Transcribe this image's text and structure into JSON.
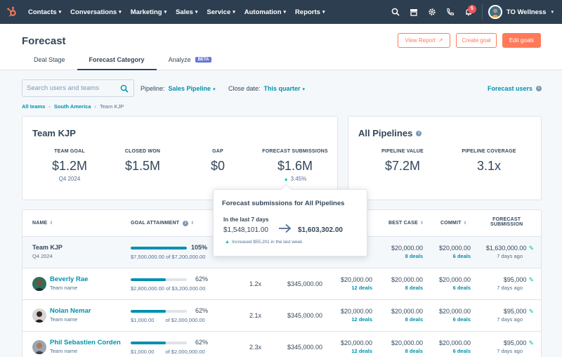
{
  "nav": {
    "items": [
      "Contacts",
      "Conversations",
      "Marketing",
      "Sales",
      "Service",
      "Automation",
      "Reports"
    ],
    "notification_count": "5",
    "account_name": "TO Wellness"
  },
  "header": {
    "title": "Forecast",
    "buttons": {
      "view_report": "View Report",
      "create_goal": "Create goal",
      "edit_goals": "Edit goals"
    },
    "tabs": [
      "Deal Stage",
      "Forecast Category",
      "Analyze"
    ],
    "beta_label": "BETA"
  },
  "filters": {
    "search_placeholder": "Search users and teams",
    "pipeline_label": "Pipeline:",
    "pipeline_value": "Sales Pipeline",
    "close_date_label": "Close date:",
    "close_date_value": "This quarter",
    "forecast_users": "Forecast users"
  },
  "breadcrumb": {
    "all_teams": "All teams",
    "region": "South America",
    "current": "Team KJP"
  },
  "team_card": {
    "title": "Team KJP",
    "metrics": [
      {
        "label": "TEAM GOAL",
        "value": "$1.2M",
        "sub": "Q4 2024"
      },
      {
        "label": "CLOSED WON",
        "value": "$1.5M",
        "sub": ""
      },
      {
        "label": "GAP",
        "value": "$0",
        "sub": ""
      },
      {
        "label": "FORECAST SUBMISSIONS",
        "value": "$1.6M",
        "sub": "3.45%"
      }
    ]
  },
  "pipelines_card": {
    "title": "All Pipelines",
    "metrics": [
      {
        "label": "PIPELINE VALUE",
        "value": "$7.2M"
      },
      {
        "label": "PIPELINE COVERAGE",
        "value": "3.1x"
      }
    ]
  },
  "popover": {
    "title": "Forecast submissions for All Pipelines",
    "period": "In the last 7 days",
    "from": "$1,548,101.00",
    "to": "$1,603,302.00",
    "increase": "Increased $55,201 in the last week"
  },
  "table": {
    "headers": {
      "name": "NAME",
      "goal": "GOAL ATTAINMENT",
      "best_case": "BEST CASE",
      "commit": "COMMIT",
      "forecast_1": "FORECAST",
      "forecast_2": "SUBMISSION"
    },
    "rows": [
      {
        "name": "Team KJP",
        "sub": "Q4 2024",
        "pct": "105%",
        "progress": 1.0,
        "attained": "$7,500,000.00",
        "goal": "of $7,200,000.00",
        "coverage": "",
        "pipeline": "",
        "col5": "",
        "col5_deals": "",
        "best": "$20,000.00",
        "best_deals": "8 deals",
        "commit": "$20,000.00",
        "commit_deals": "6 deals",
        "forecast": "$1,630,000.00",
        "forecast_ago": "7 days ago"
      },
      {
        "name": "Beverly Rae",
        "sub": "Team name",
        "pct": "62%",
        "progress": 0.62,
        "attained": "$2,800,000.00",
        "goal": "of $3,200,000.00",
        "coverage": "1.2x",
        "pipeline": "$345,000.00",
        "col5": "$20,000.00",
        "col5_deals": "12 deals",
        "best": "$20,000.00",
        "best_deals": "8 deals",
        "commit": "$20,000.00",
        "commit_deals": "6 deals",
        "forecast": "$95,000",
        "forecast_ago": "7 days ago"
      },
      {
        "name": "Nolan Nemar",
        "sub": "Team name",
        "pct": "62%",
        "progress": 0.62,
        "attained": "$1,000.00",
        "goal": "of $2,000,000.00",
        "coverage": "2.1x",
        "pipeline": "$345,000.00",
        "col5": "$20,000.00",
        "col5_deals": "12 deals",
        "best": "$20,000.00",
        "best_deals": "8 deals",
        "commit": "$20,000.00",
        "commit_deals": "6 deals",
        "forecast": "$95,000",
        "forecast_ago": "7 days ago"
      },
      {
        "name": "Phil Sebastien Corden",
        "sub": "Team name",
        "pct": "62%",
        "progress": 0.62,
        "attained": "$1,000.00",
        "goal": "of $2,000,000.00",
        "coverage": "2.3x",
        "pipeline": "$345,000.00",
        "col5": "$20,000.00",
        "col5_deals": "12 deals",
        "best": "$20,000.00",
        "best_deals": "8 deals",
        "commit": "$20,000.00",
        "commit_deals": "6 deals",
        "forecast": "$95,000",
        "forecast_ago": "7 days ago"
      }
    ]
  }
}
